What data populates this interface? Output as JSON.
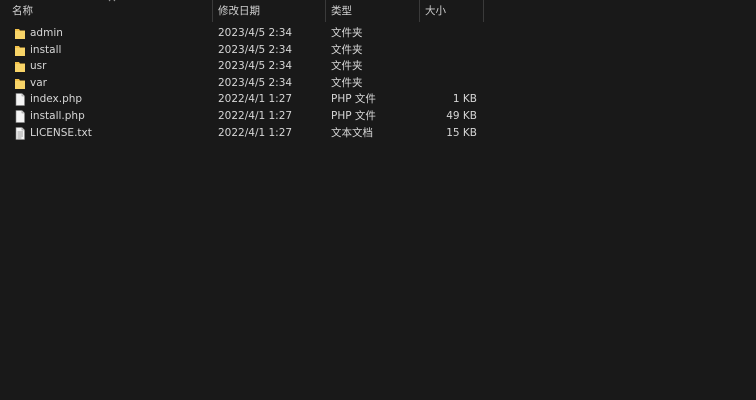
{
  "columns": {
    "name": "名称",
    "date": "修改日期",
    "type": "类型",
    "size": "大小"
  },
  "files": [
    {
      "name": "admin",
      "date": "2023/4/5 2:34",
      "type": "文件夹",
      "size": "",
      "icon": "folder-icon"
    },
    {
      "name": "install",
      "date": "2023/4/5 2:34",
      "type": "文件夹",
      "size": "",
      "icon": "folder-icon"
    },
    {
      "name": "usr",
      "date": "2023/4/5 2:34",
      "type": "文件夹",
      "size": "",
      "icon": "folder-icon"
    },
    {
      "name": "var",
      "date": "2023/4/5 2:34",
      "type": "文件夹",
      "size": "",
      "icon": "folder-icon"
    },
    {
      "name": "index.php",
      "date": "2022/4/1 1:27",
      "type": "PHP 文件",
      "size": "1 KB",
      "icon": "file-icon"
    },
    {
      "name": "install.php",
      "date": "2022/4/1 1:27",
      "type": "PHP 文件",
      "size": "49 KB",
      "icon": "file-icon"
    },
    {
      "name": "LICENSE.txt",
      "date": "2022/4/1 1:27",
      "type": "文本文档",
      "size": "15 KB",
      "icon": "text-file-icon"
    }
  ],
  "colors": {
    "background": "#191919",
    "text": "#d6d6d6",
    "folder": "#f3c24a"
  }
}
